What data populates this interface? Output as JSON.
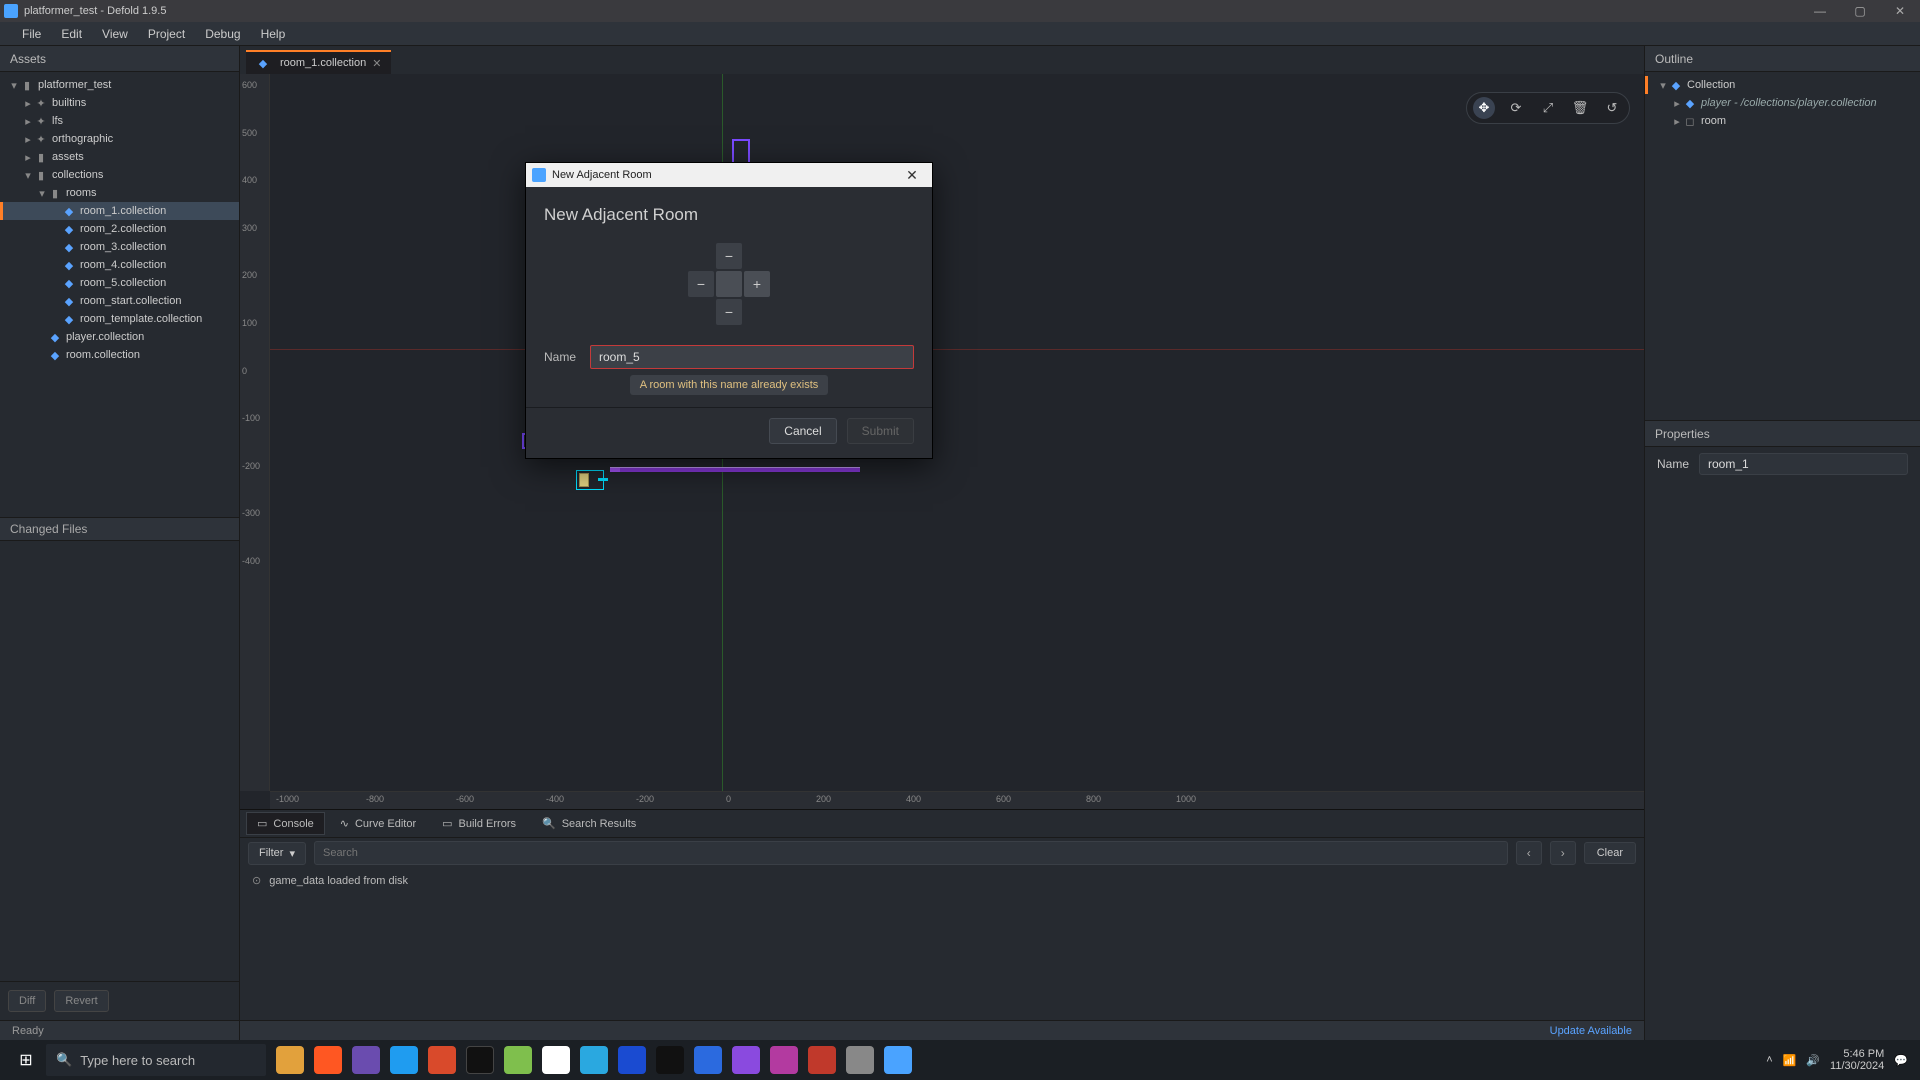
{
  "window": {
    "title": "platformer_test - Defold 1.9.5"
  },
  "menubar": [
    "File",
    "Edit",
    "View",
    "Project",
    "Debug",
    "Help"
  ],
  "assets": {
    "header": "Assets",
    "changed_header": "Changed Files",
    "buttons": {
      "diff": "Diff",
      "revert": "Revert"
    },
    "tree": [
      {
        "depth": 0,
        "chev": "▾",
        "icon": "folder",
        "label": "platformer_test"
      },
      {
        "depth": 1,
        "chev": "▸",
        "icon": "obj",
        "label": "builtins"
      },
      {
        "depth": 1,
        "chev": "▸",
        "icon": "obj",
        "label": "lfs"
      },
      {
        "depth": 1,
        "chev": "▸",
        "icon": "obj",
        "label": "orthographic"
      },
      {
        "depth": 1,
        "chev": "▸",
        "icon": "folder",
        "label": "assets"
      },
      {
        "depth": 1,
        "chev": "▾",
        "icon": "folder",
        "label": "collections"
      },
      {
        "depth": 2,
        "chev": "▾",
        "icon": "folder",
        "label": "rooms"
      },
      {
        "depth": 3,
        "chev": "",
        "icon": "coll",
        "label": "room_1.collection",
        "selected": true
      },
      {
        "depth": 3,
        "chev": "",
        "icon": "coll",
        "label": "room_2.collection"
      },
      {
        "depth": 3,
        "chev": "",
        "icon": "coll",
        "label": "room_3.collection"
      },
      {
        "depth": 3,
        "chev": "",
        "icon": "coll",
        "label": "room_4.collection"
      },
      {
        "depth": 3,
        "chev": "",
        "icon": "coll",
        "label": "room_5.collection"
      },
      {
        "depth": 3,
        "chev": "",
        "icon": "coll",
        "label": "room_start.collection"
      },
      {
        "depth": 3,
        "chev": "",
        "icon": "coll",
        "label": "room_template.collection"
      },
      {
        "depth": 2,
        "chev": "",
        "icon": "coll",
        "label": "player.collection"
      },
      {
        "depth": 2,
        "chev": "",
        "icon": "coll",
        "label": "room.collection"
      }
    ]
  },
  "editor": {
    "tab_label": "room_1.collection",
    "ruler_x": [
      "-1000",
      "-800",
      "-600",
      "-400",
      "-200",
      "0",
      "200",
      "400",
      "600",
      "800",
      "1000"
    ],
    "ruler_y": [
      "600",
      "500",
      "400",
      "300",
      "200",
      "100",
      "0",
      "-100",
      "-200",
      "-300",
      "-400"
    ],
    "tools": [
      "move",
      "rotate",
      "scale",
      "delete",
      "reload"
    ]
  },
  "bottom": {
    "tabs": [
      "Console",
      "Curve Editor",
      "Build Errors",
      "Search Results"
    ],
    "filter": "Filter",
    "search_placeholder": "Search",
    "clear": "Clear",
    "log": "game_data loaded from disk"
  },
  "status": {
    "left": "Ready",
    "right": "Update Available"
  },
  "outline": {
    "header": "Outline",
    "rows": [
      {
        "depth": 0,
        "chev": "▾",
        "icon": "coll",
        "label": "Collection",
        "sel": true
      },
      {
        "depth": 1,
        "chev": "▸",
        "icon": "coll",
        "label": "player - /collections/player.collection",
        "italic": true
      },
      {
        "depth": 1,
        "chev": "▸",
        "icon": "obj",
        "label": "room"
      }
    ]
  },
  "properties": {
    "header": "Properties",
    "name_label": "Name",
    "name_value": "room_1"
  },
  "dialog": {
    "chrome_title": "New Adjacent Room",
    "heading": "New Adjacent Room",
    "name_label": "Name",
    "name_value": "room_5",
    "error": "A room with this name already exists",
    "cancel": "Cancel",
    "submit": "Submit",
    "dpad": {
      "minus": "−",
      "plus": "+"
    }
  },
  "taskbar": {
    "search_placeholder": "Type here to search",
    "time": "5:46 PM",
    "date": "11/30/2024"
  }
}
